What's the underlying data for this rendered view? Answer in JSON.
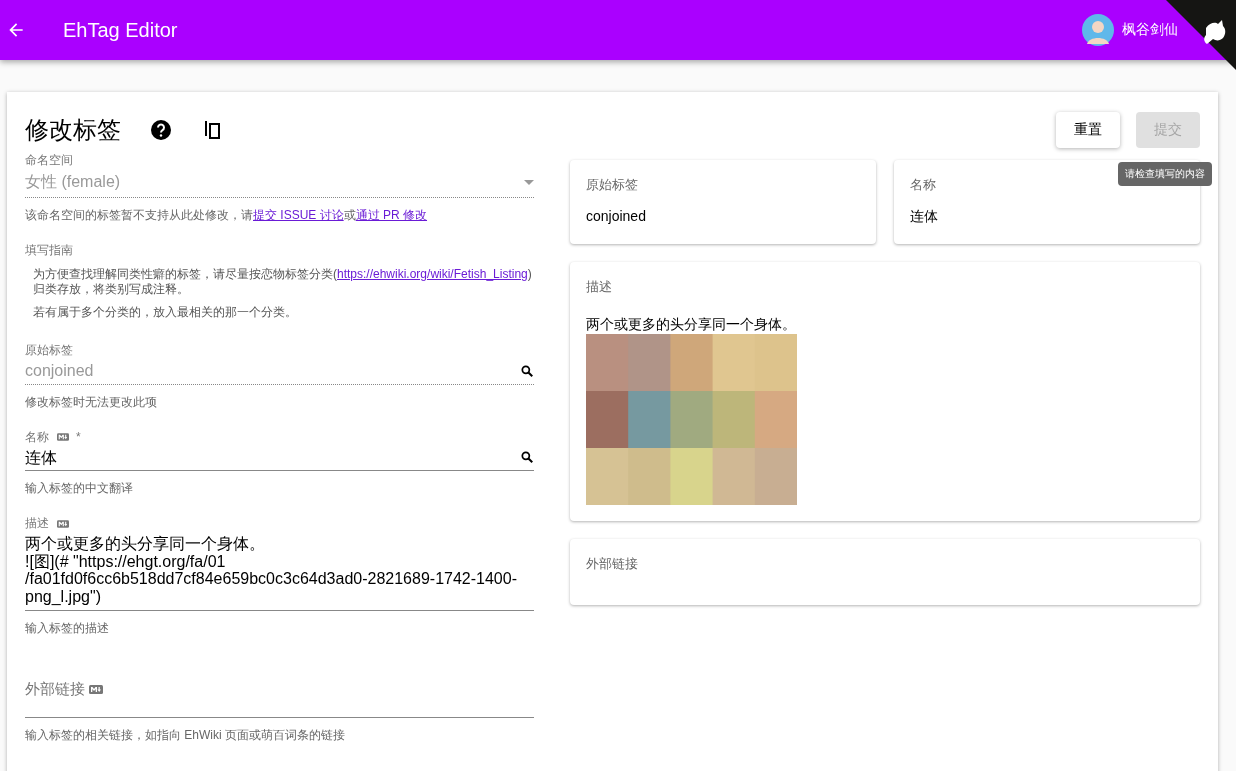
{
  "app_bar": {
    "title": "EhTag Editor",
    "user_name": "枫谷剑仙"
  },
  "page": {
    "title": "修改标签",
    "tooltip": "请检查填写的内容",
    "buttons": [
      {
        "label": "重置",
        "disabled": false
      },
      {
        "label": "提交",
        "disabled": true
      }
    ]
  },
  "namespace": {
    "label": "命名空间",
    "value": "女性 (female)",
    "disabled": true,
    "hint": [
      {
        "text": "该命名空间的标签暂不支持从此处修改，请",
        "link": false
      },
      {
        "text": "提交 ISSUE 讨论",
        "link": true
      },
      {
        "text": "或",
        "link": false
      },
      {
        "text": "通过 PR 修改",
        "link": true
      }
    ]
  },
  "guide": {
    "title": "填写指南",
    "paragraphs": [
      [
        {
          "text": "为方便查找理解同类性癖的标签，请尽量按恋物标签分类(",
          "link": false
        },
        {
          "text": "https://ehwiki.org/wiki/Fetish_Listing",
          "link": true
        },
        {
          "text": ")归类存放，将类别写成注释。",
          "link": false
        }
      ],
      [
        {
          "text": "若有属于多个分类的，放入最相关的那一个分类。",
          "link": false
        }
      ]
    ]
  },
  "fields": [
    {
      "kind": "text",
      "label": "原始标签",
      "markdown": false,
      "disabled": true,
      "search": true,
      "value": "conjoined",
      "hint": "修改标签时无法更改此项"
    },
    {
      "kind": "text",
      "label": "名称",
      "markdown": true,
      "required_mark": "*",
      "disabled": false,
      "search": true,
      "value": "连体",
      "hint": "输入标签的中文翻译"
    },
    {
      "kind": "textarea",
      "label": "描述",
      "markdown": true,
      "disabled": false,
      "search": false,
      "value": "两个或更多的头分享同一个身体。\n![图](# \"https://ehgt.org/fa/01\n/fa01fd0f6cc6b518dd7cf84e659bc0c3c64d3ad0-2821689-1742-1400-\npng_l.jpg\")",
      "hint": "输入标签的描述"
    },
    {
      "kind": "empty",
      "label": "外部链接",
      "markdown": true,
      "disabled": false,
      "hint": "输入标签的相关链接，如指向 EhWiki 页面或萌百词条的链接"
    }
  ],
  "preview": [
    {
      "kind": "small",
      "title": "原始标签",
      "text": "conjoined"
    },
    {
      "kind": "small",
      "title": "名称",
      "text": "连体"
    },
    {
      "title": "描述",
      "text": "两个或更多的头分享同一个身体。"
    },
    {
      "kind": "empty",
      "title": "外部链接"
    }
  ]
}
